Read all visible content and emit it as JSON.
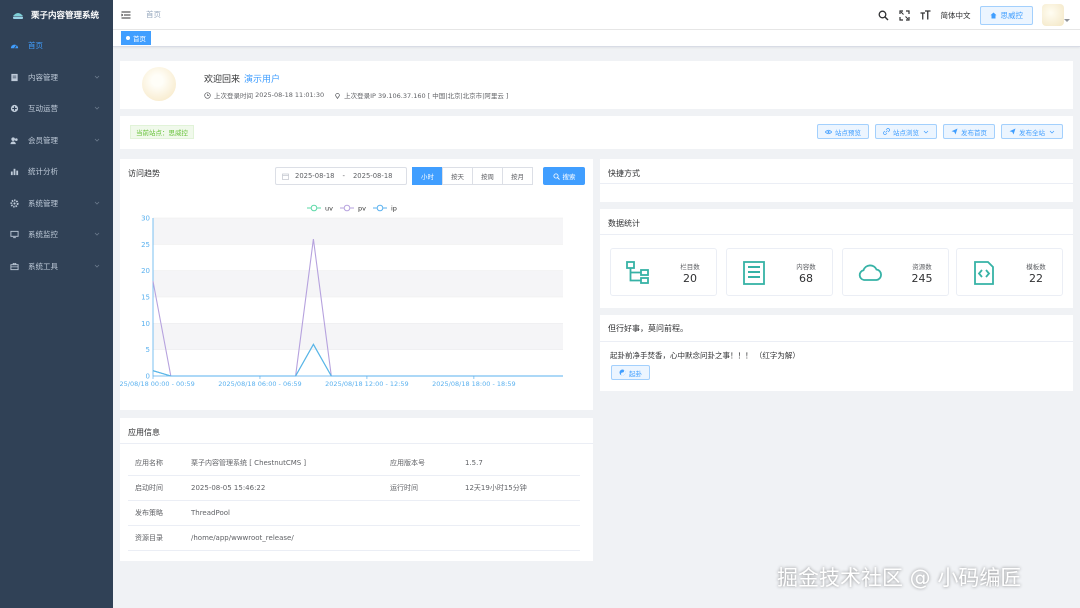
{
  "sidebar": {
    "logo_text": "栗子内容管理系统",
    "items": [
      {
        "label": "首页",
        "icon": "dashboard-icon",
        "active": true
      },
      {
        "label": "内容管理",
        "icon": "document-icon",
        "has_children": true
      },
      {
        "label": "互动运营",
        "icon": "interact-icon",
        "has_children": true
      },
      {
        "label": "会员管理",
        "icon": "users-icon",
        "has_children": true
      },
      {
        "label": "统计分析",
        "icon": "bar-chart-icon",
        "has_children": false
      },
      {
        "label": "系统管理",
        "icon": "gear-icon",
        "has_children": true
      },
      {
        "label": "系统监控",
        "icon": "monitor-icon",
        "has_children": true
      },
      {
        "label": "系统工具",
        "icon": "toolbox-icon",
        "has_children": true
      }
    ]
  },
  "header": {
    "breadcrumb": "首页",
    "language": "简体中文",
    "site_button": "思威控"
  },
  "tags": {
    "active_tag": "首页"
  },
  "welcome": {
    "greeting": "欢迎回来",
    "username": "演示用户",
    "last_login_label": "上次登录时间",
    "last_login_time": "2025-08-18 11:01:30",
    "last_ip_label": "上次登录IP",
    "last_ip": "39.106.37.160 [ 中国|北京|北京市|阿里云 ]"
  },
  "site_bar": {
    "current_site": "当前站点：思威控",
    "actions": [
      {
        "label": "站点预览",
        "dropdown": false
      },
      {
        "label": "站点浏览",
        "dropdown": true
      },
      {
        "label": "发布首页",
        "dropdown": false
      },
      {
        "label": "发布全站",
        "dropdown": true
      }
    ]
  },
  "trend": {
    "title": "访问趋势",
    "start_date": "2025-08-18",
    "range_sep": "-",
    "end_date": "2025-08-18",
    "segments": [
      "小时",
      "按天",
      "按周",
      "按月"
    ],
    "active_segment": 0,
    "search_label": "搜索"
  },
  "chart_data": {
    "type": "line",
    "legend": [
      "uv",
      "pv",
      "ip"
    ],
    "legend_position": "top-center",
    "colors": {
      "uv": "#5ad8a6",
      "pv": "#b6a2de",
      "ip": "#5ab1ef"
    },
    "ylim": [
      0,
      30
    ],
    "yticks": [
      0,
      5,
      10,
      15,
      20,
      25,
      30
    ],
    "xtick_labels": [
      "2025/08/18 00:00 - 00:59",
      "2025/08/18 06:00 - 06:59",
      "2025/08/18 12:00 - 12:59",
      "2025/08/18 18:00 - 18:59"
    ],
    "xtick_indices": [
      0,
      6,
      12,
      18
    ],
    "x_count": 24,
    "series": [
      {
        "name": "uv",
        "values": [
          1,
          0,
          0,
          0,
          0,
          0,
          0,
          0,
          0,
          6,
          0,
          0,
          0,
          0,
          0,
          0,
          0,
          0,
          0,
          0,
          0,
          0,
          0,
          0
        ]
      },
      {
        "name": "pv",
        "values": [
          18,
          0,
          0,
          0,
          0,
          0,
          0,
          0,
          0,
          26,
          0,
          0,
          0,
          0,
          0,
          0,
          0,
          0,
          0,
          0,
          0,
          0,
          0,
          0
        ]
      },
      {
        "name": "ip",
        "values": [
          1,
          0,
          0,
          0,
          0,
          0,
          0,
          0,
          0,
          6,
          0,
          0,
          0,
          0,
          0,
          0,
          0,
          0,
          0,
          0,
          0,
          0,
          0,
          0
        ]
      }
    ],
    "grid": true
  },
  "app_info": {
    "title": "应用信息",
    "rows": [
      {
        "k1": "应用名称",
        "v1": "栗子内容管理系统 [ ChestnutCMS ]",
        "k2": "应用版本号",
        "v2": "1.5.7"
      },
      {
        "k1": "启动时间",
        "v1": "2025-08-05 15:46:22",
        "k2": "运行时间",
        "v2": "12天19小时15分钟"
      },
      {
        "k1": "发布策略",
        "v1": "ThreadPool",
        "k2": "",
        "v2": ""
      },
      {
        "k1": "资源目录",
        "v1": "/home/app/wwwroot_release/",
        "k2": "",
        "v2": ""
      }
    ]
  },
  "shortcuts": {
    "title": "快捷方式"
  },
  "stats": {
    "title": "数据统计",
    "accent": "#36b2a6",
    "items": [
      {
        "label": "栏目数",
        "value": "20",
        "icon": "tree-icon"
      },
      {
        "label": "内容数",
        "value": "68",
        "icon": "article-icon"
      },
      {
        "label": "资源数",
        "value": "245",
        "icon": "cloud-icon"
      },
      {
        "label": "模板数",
        "value": "22",
        "icon": "code-file-icon"
      }
    ]
  },
  "motto": {
    "title": "但行好事，莫问前程。",
    "text": "起卦前净手焚香，心中默念问卦之事！！！ （红字为解）",
    "button": "起卦"
  },
  "watermark": "掘金技术社区 @ 小码编匠"
}
